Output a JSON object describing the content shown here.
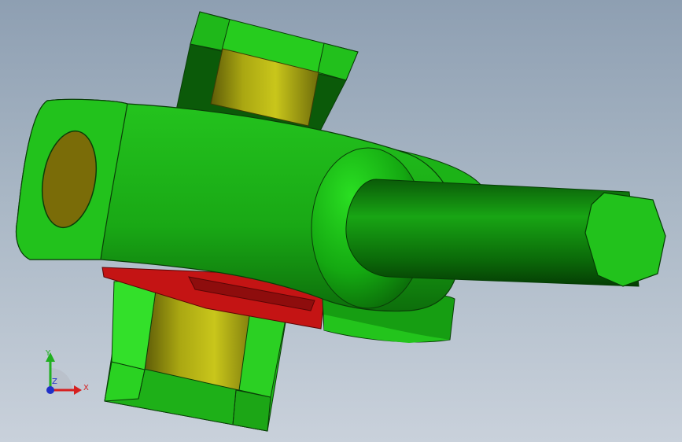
{
  "viewport": {
    "background": "#a9b7c5",
    "model": {
      "body_color": "#1fb81a",
      "pin_color": "#b7b516",
      "insert_color": "#c41414"
    }
  },
  "triad": {
    "x_label": "X",
    "y_label": "Y",
    "z_label": "Z",
    "x_color": "#d62020",
    "y_color": "#20b020",
    "z_color": "#2030c8"
  }
}
